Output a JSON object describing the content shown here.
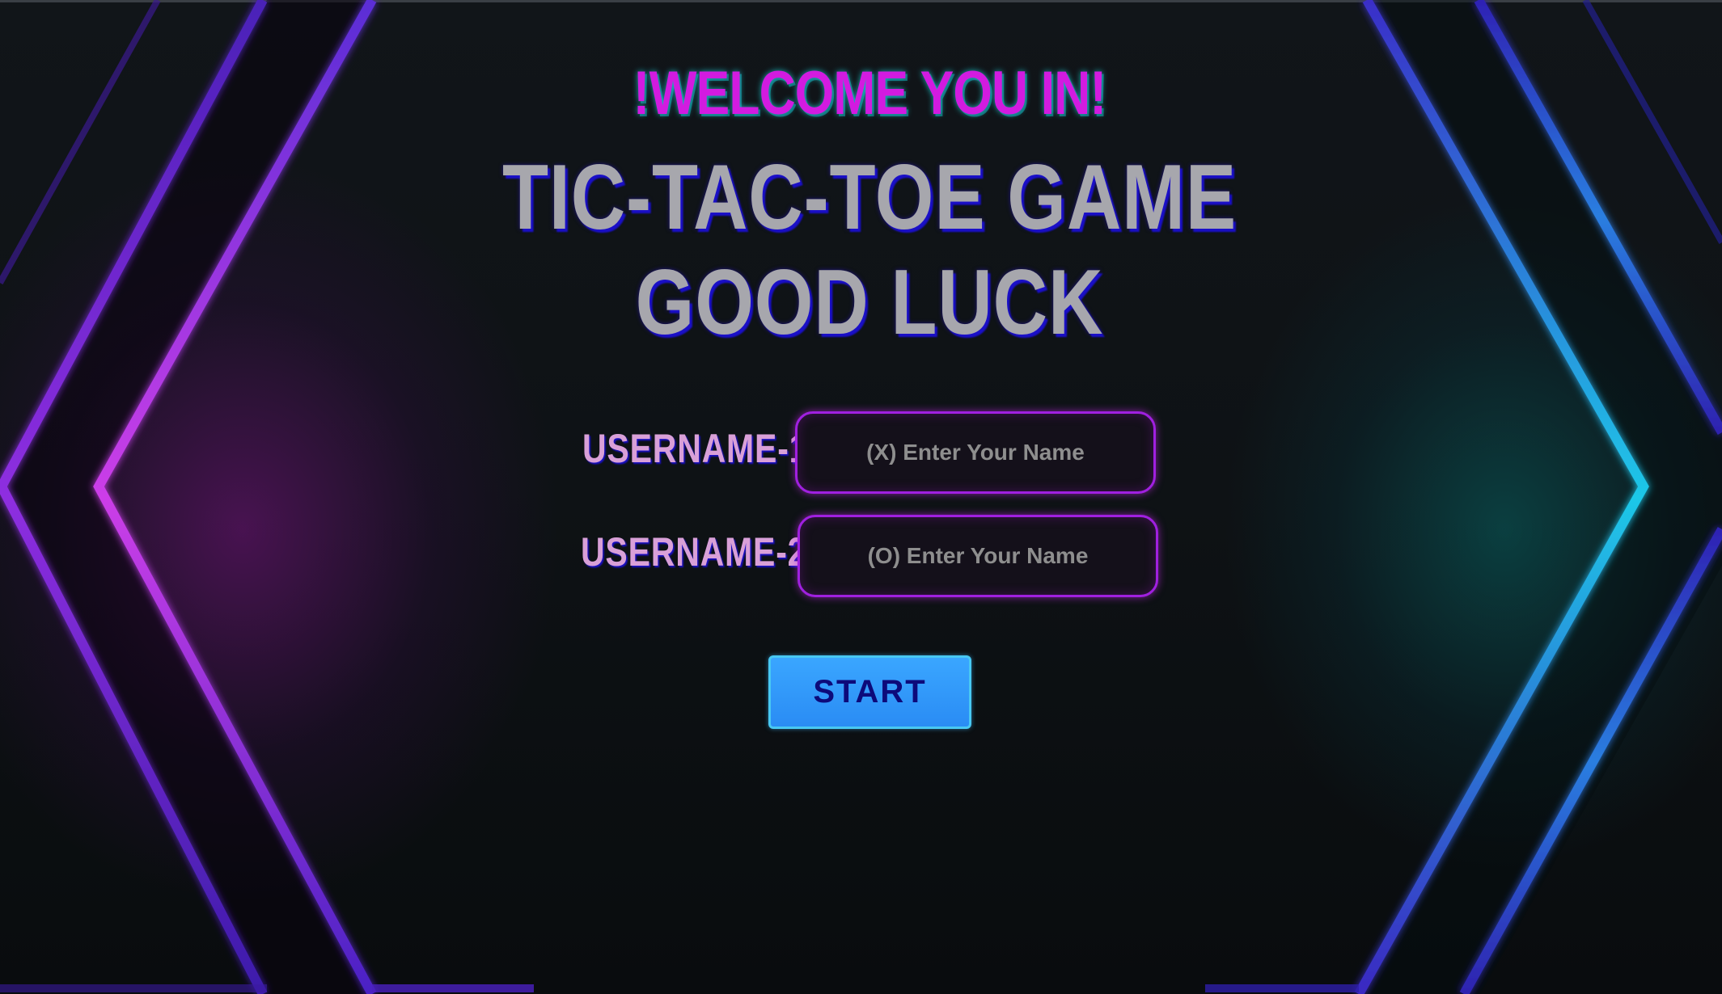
{
  "header": {
    "welcome": "!WELCOME YOU IN!",
    "title_line1": "TIC-TAC-TOE GAME",
    "title_line2": "GOOD LUCK"
  },
  "form": {
    "player1": {
      "label": "USERNAME-1",
      "placeholder": "(X) Enter Your Name",
      "value": ""
    },
    "player2": {
      "label": "USERNAME-2",
      "placeholder": "(O) Enter Your Name",
      "value": ""
    },
    "start_label": "START"
  },
  "colors": {
    "welcome": "#d21be0",
    "title": "#a7a7ad",
    "label": "#d9a0d8",
    "input_border": "#a020e0",
    "button_bg": "#2a8cf4",
    "button_text": "#0d0a7a",
    "left_glow": "#c53ae6",
    "right_glow": "#1cc4e6"
  }
}
